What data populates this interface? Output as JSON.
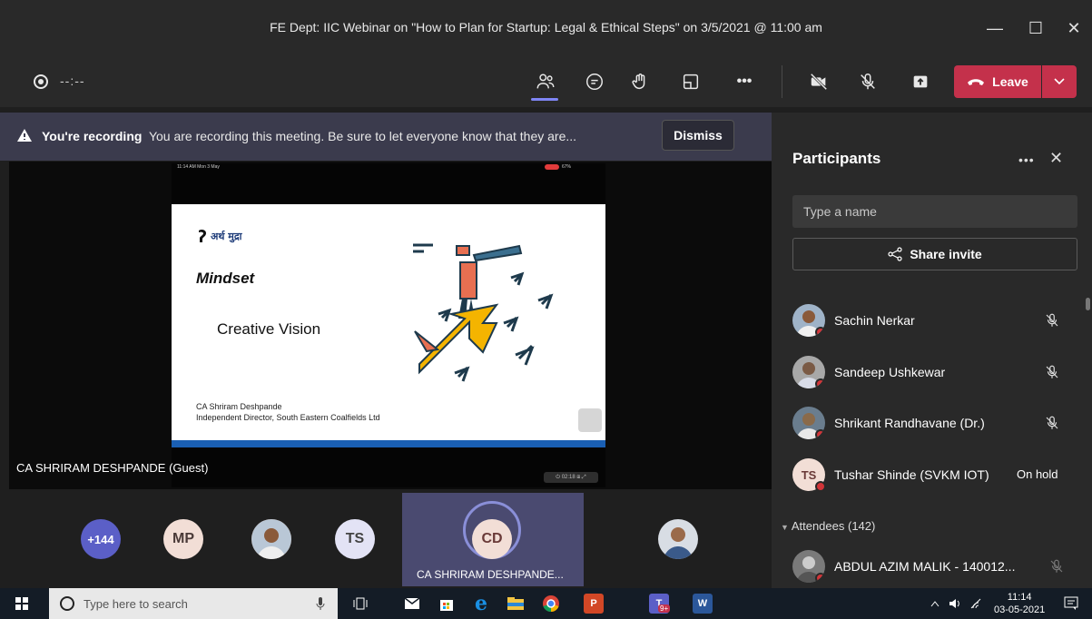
{
  "window": {
    "title": "FE Dept: IIC Webinar on \"How to Plan for Startup: Legal & Ethical Steps\" on 3/5/2021 @ 11:00 am",
    "minimize_icon": "minimize-icon",
    "maximize_icon": "maximize-icon",
    "close_icon": "close-icon"
  },
  "toolbar": {
    "timer": "--:--",
    "leave_label": "Leave",
    "icons": [
      "participants-icon",
      "chat-icon",
      "raise-hand-icon",
      "breakout-icon",
      "more-icon",
      "camera-off-icon",
      "mic-off-icon",
      "share-icon"
    ],
    "leave_color": "#c4314b",
    "active_accent": "#7f85f5"
  },
  "banner": {
    "title": "You're recording",
    "message": "You are recording this meeting. Be sure to let everyone know that they are...",
    "dismiss_label": "Dismiss"
  },
  "stage": {
    "status_time": "11:14 AM  Mon 3 May",
    "status_right": "67%",
    "slide": {
      "logo_text": "अर्थ मुद्रा",
      "heading": "Mindset",
      "subtitle": "Creative Vision",
      "presenter_line1": "CA Shriram Deshpande",
      "presenter_line2": "Independent Director, South Eastern Coalfields Ltd"
    },
    "controls_text": "⏻ 02:18 ⊞ ⤢",
    "speaker_name": "CA SHRIRAM DESHPANDE (Guest)"
  },
  "gallery": {
    "overflow_count": "+144",
    "tiles": [
      {
        "initials": "MP"
      },
      {
        "initials": "TS"
      },
      {
        "initials": "CD"
      }
    ],
    "featured_name": "CA SHRIRAM DESHPANDE..."
  },
  "panel": {
    "heading": "Participants",
    "more": "•••",
    "close": "✕",
    "search_placeholder": "Type a name",
    "share_label": "Share invite",
    "participants": [
      {
        "name": "Sachin Nerkar",
        "status": ""
      },
      {
        "name": "Sandeep Ushkewar",
        "status": ""
      },
      {
        "name": "Shrikant Randhavane (Dr.)",
        "status": ""
      },
      {
        "name": "Tushar Shinde (SVKM IOT)",
        "status": "On hold",
        "initials": "TS"
      }
    ],
    "attendees_label": "Attendees (142)",
    "attendee": {
      "name": "ABDUL AZIM MALIK - 140012..."
    }
  },
  "taskbar": {
    "search_placeholder": "Type here to search",
    "time": "11:14",
    "date": "03-05-2021",
    "teams_badge": "9+"
  }
}
